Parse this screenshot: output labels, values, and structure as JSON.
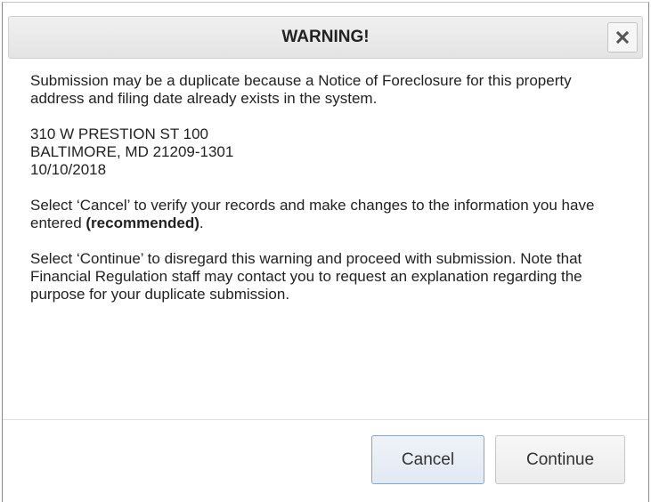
{
  "dialog": {
    "title": "WARNING!",
    "close_icon": "close-icon",
    "paragraphs": {
      "intro": "Submission may be a duplicate because a Notice of Foreclosure for this property address and filing date already exists in the system.",
      "cancel_text": "Select ‘Cancel’ to verify your records and make changes to the information you have entered ",
      "cancel_emphasis": "(recommended)",
      "cancel_end": ".",
      "continue_text": "Select ‘Continue’ to disregard this warning and proceed with submission. Note that Financial Regulation staff may contact you to request an explanation regarding the purpose for your duplicate submission."
    },
    "address": {
      "street": "310 W PRESTION ST 100",
      "city_state_zip": "BALTIMORE, MD 21209-1301",
      "date": "10/10/2018"
    },
    "buttons": {
      "cancel": "Cancel",
      "continue": "Continue"
    }
  }
}
